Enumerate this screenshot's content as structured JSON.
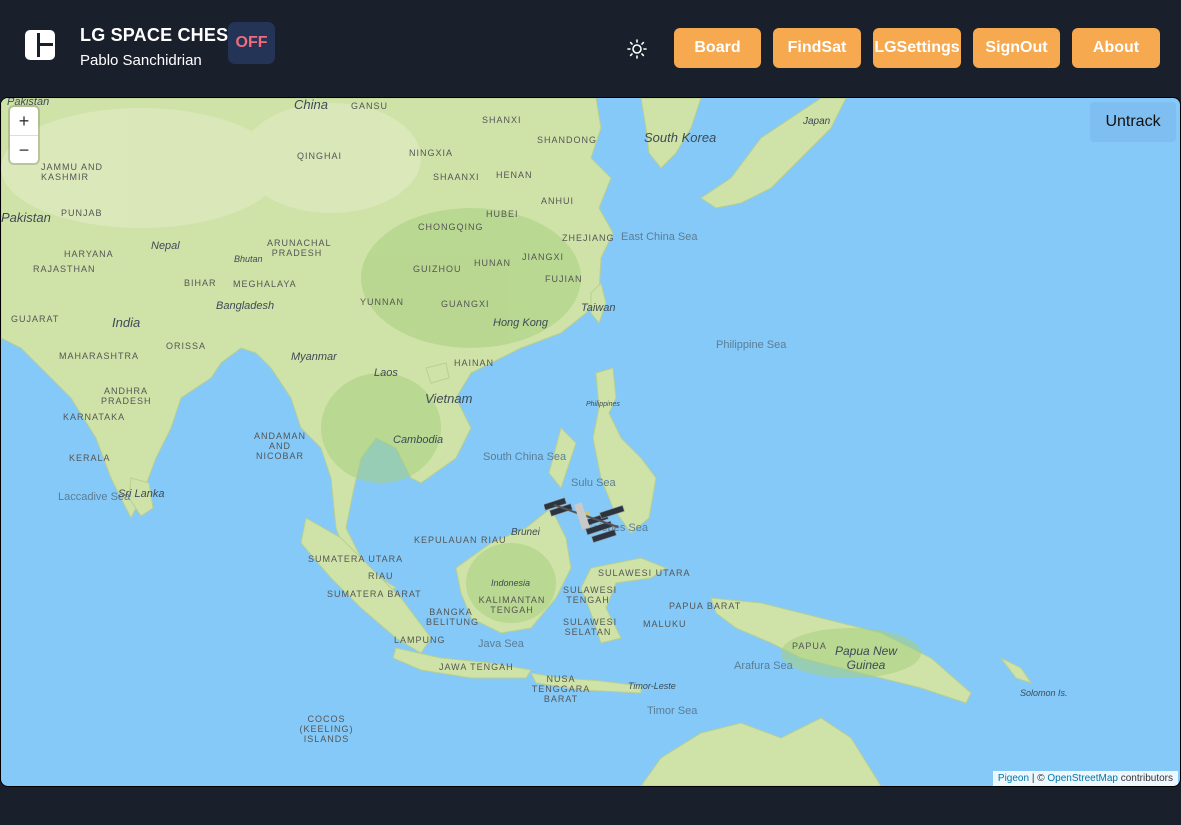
{
  "header": {
    "app_title": "LG SPACE CHESS",
    "user_name": "Pablo Sanchidrian",
    "status_badge": "OFF",
    "theme_icon": "sun-icon",
    "logo_icon": "dashboard-icon"
  },
  "nav": {
    "board": "Board",
    "findsat": "FindSat",
    "lgsettings": "LGSettings",
    "signout": "SignOut",
    "about": "About"
  },
  "colors": {
    "background": "#1a1f2c",
    "nav_button": "#f7a94f",
    "badge_bg": "#233457",
    "badge_text": "#f26b7a",
    "water": "#84c9f7",
    "land": "#cfe3a8"
  },
  "map": {
    "zoom_in": "+",
    "zoom_out": "−",
    "untrack": "Untrack",
    "attribution": {
      "pigeon": "Pigeon",
      "separator": " | © ",
      "osm": "OpenStreetMap",
      "suffix": " contributors"
    },
    "satellite_icon": "iss-satellite-icon",
    "labels": {
      "china": "China",
      "gansu": "GANSU",
      "shanxi": "SHANXI",
      "shandong": "SHANDONG",
      "south_korea": "South Korea",
      "japan": "Japan",
      "pakistan_top": "Pakistan",
      "jammu": "JAMMU AND KASHMIR",
      "qinghai": "QINGHAI",
      "ningxia": "NINGXIA",
      "shaanxi": "SHAANXI",
      "henan": "HENAN",
      "anhui": "ANHUI",
      "hubei": "HUBEI",
      "pakistan": "Pakistan",
      "punjab": "PUNJAB",
      "chongqing": "CHONGQING",
      "zhejiang": "ZHEJIANG",
      "east_china_sea": "East China Sea",
      "nepal": "Nepal",
      "arunachal": "ARUNACHAL PRADESH",
      "haryana": "HARYANA",
      "bhutan": "Bhutan",
      "hunan": "HUNAN",
      "jiangxi": "JIANGXI",
      "rajasthan": "RAJASTHAN",
      "guizhou": "GUIZHOU",
      "fujian": "FUJIAN",
      "bihar": "BIHAR",
      "meghalaya": "MEGHALAYA",
      "yunnan": "YUNNAN",
      "guangxi": "GUANGXI",
      "bangladesh": "Bangladesh",
      "taiwan": "Taiwan",
      "gujarat": "GUJARAT",
      "india": "India",
      "hong_kong": "Hong Kong",
      "maharashtra": "MAHARASHTRA",
      "orissa": "ORISSA",
      "myanmar": "Myanmar",
      "philippine_sea": "Philippine Sea",
      "hainan": "HAINAN",
      "laos": "Laos",
      "andhra": "ANDHRA PRADESH",
      "vietnam": "Vietnam",
      "karnataka": "KARNATAKA",
      "philippines": "Philippines",
      "andaman": "ANDAMAN AND NICOBAR",
      "cambodia": "Cambodia",
      "south_china_sea": "South China Sea",
      "kerala": "KERALA",
      "sulu_sea": "Sulu Sea",
      "laccadive_sea": "Laccadive Sea",
      "sri_lanka": "Sri Lanka",
      "brunei": "Brunei",
      "celebes_sea": "Celebes Sea",
      "kepulauan_riau": "KEPULAUAN RIAU",
      "sumatera_utara": "SUMATERA UTARA",
      "riau": "RIAU",
      "sulawesi_utara": "SULAWESI UTARA",
      "indonesia": "Indonesia",
      "sumatera_barat": "SUMATERA BARAT",
      "kalimantan_tengah": "KALIMANTAN TENGAH",
      "sulawesi_tengah": "SULAWESI TENGAH",
      "papua_barat": "PAPUA BARAT",
      "bangka_belitung": "BANGKA BELITUNG",
      "maluku": "MALUKU",
      "sulawesi_selatan": "SULAWESI SELATAN",
      "lampung": "LAMPUNG",
      "java_sea": "Java Sea",
      "papua": "PAPUA",
      "papua_new_guinea": "Papua New Guinea",
      "jawa_tengah": "JAWA TENGAH",
      "arafura_sea": "Arafura Sea",
      "nusa_tenggara": "NUSA TENGGARA BARAT",
      "timor_leste": "Timor-Leste",
      "solomon_is": "Solomon Is.",
      "cocos": "COCOS (KEELING) ISLANDS",
      "timor_sea": "Timor Sea"
    }
  }
}
